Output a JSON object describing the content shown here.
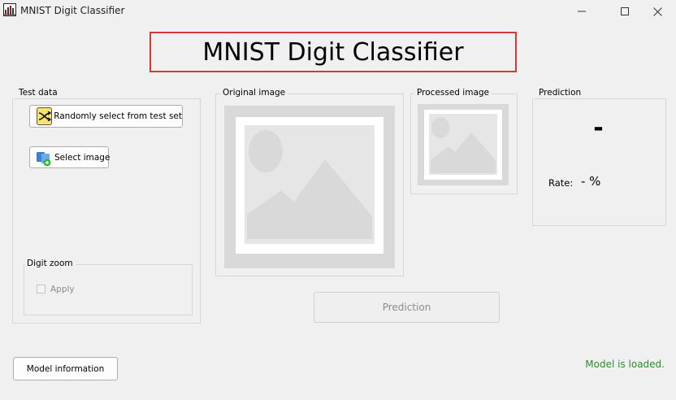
{
  "window": {
    "title": "MNIST Digit Classifier",
    "controls": [
      "minimize-icon",
      "maximize-icon",
      "close-icon"
    ]
  },
  "header": {
    "title": "MNIST Digit Classifier",
    "border_color": "#d03a3a"
  },
  "test_data": {
    "label": "Test data",
    "random_button": "Randomly select from test set",
    "select_button": "Select image",
    "random_icon": "shuffle-icon",
    "select_icon": "image-file-icon"
  },
  "digit_zoom": {
    "label": "Digit zoom",
    "apply_label": "Apply",
    "apply_checked": false
  },
  "original_image": {
    "label": "Original image",
    "placeholder_icon": "image-placeholder-icon"
  },
  "processed_image": {
    "label": "Processed image",
    "placeholder_icon": "image-placeholder-icon"
  },
  "prediction": {
    "label": "Prediction",
    "value": "-",
    "rate_label": "Rate:",
    "rate_value": "- %"
  },
  "prediction_button": {
    "label": "Prediction",
    "enabled": false
  },
  "model_info_button": {
    "label": "Model information"
  },
  "status": {
    "text": "Model is loaded.",
    "color": "#2e8b2e"
  }
}
